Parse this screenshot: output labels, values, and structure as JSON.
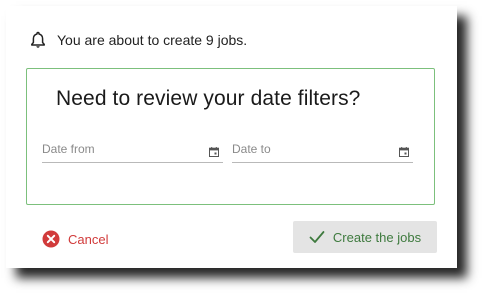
{
  "notice": {
    "icon": "bell-icon",
    "text": "You are about to create 9 jobs."
  },
  "filters": {
    "title": "Need to review your date filters?",
    "date_from": {
      "placeholder": "Date from",
      "value": "",
      "icon": "calendar-icon"
    },
    "date_to": {
      "placeholder": "Date to",
      "value": "",
      "icon": "calendar-icon"
    }
  },
  "actions": {
    "cancel": {
      "label": "Cancel",
      "icon": "cancel-circle-icon"
    },
    "create": {
      "label": "Create the jobs",
      "icon": "check-icon"
    }
  },
  "colors": {
    "filter_border": "#7cc07c",
    "cancel": "#d13b3b",
    "create_text": "#3e7a3e",
    "create_bg": "#e4e4e4"
  }
}
